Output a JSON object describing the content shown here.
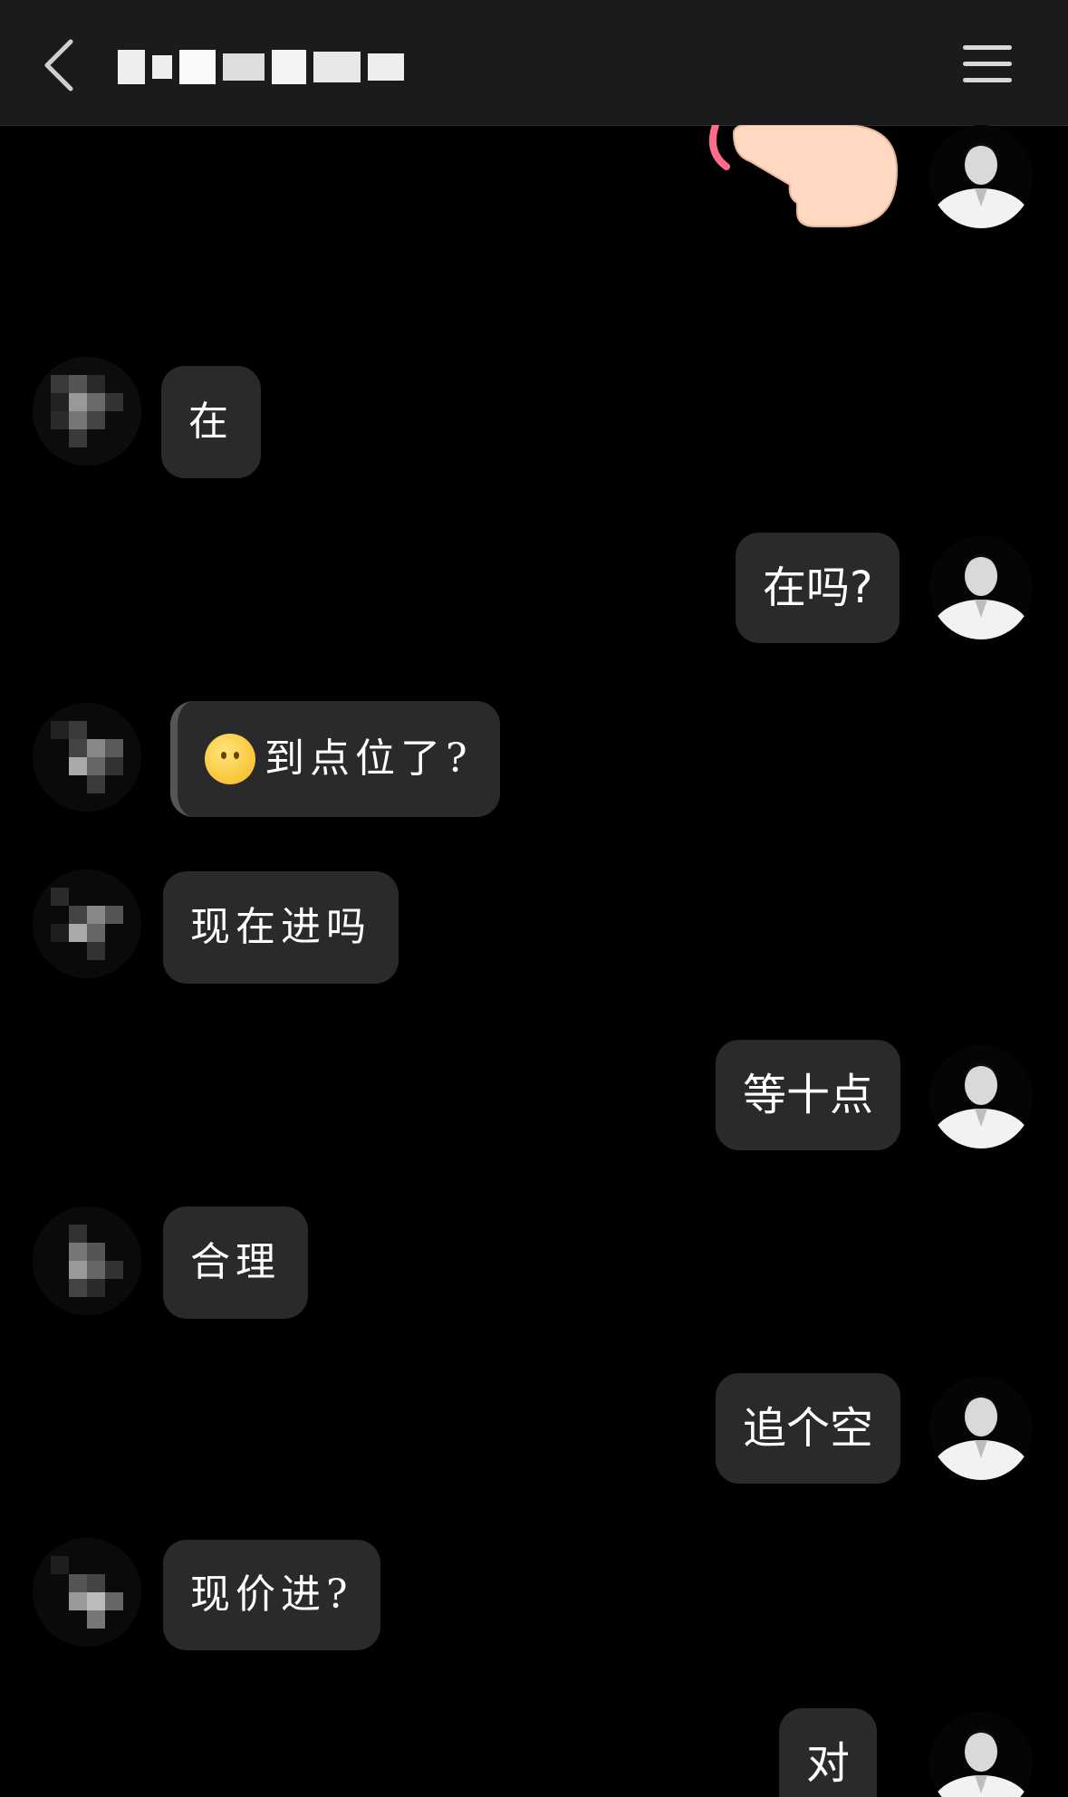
{
  "header": {
    "title": "redacted contact name",
    "back_icon": "chevron-left-icon",
    "menu_icon": "hamburger-menu-icon"
  },
  "messages": [
    {
      "from": "me",
      "type": "sticker",
      "sticker": "pointing-hand-sticker"
    },
    {
      "from": "other",
      "text": "在"
    },
    {
      "from": "me",
      "text": "在吗?"
    },
    {
      "from": "other",
      "emoji": "thinking-face-emoji",
      "text": "到点位了?"
    },
    {
      "from": "other",
      "text": "现在进吗"
    },
    {
      "from": "me",
      "text": "等十点"
    },
    {
      "from": "other",
      "text": "合理"
    },
    {
      "from": "me",
      "text": "追个空"
    },
    {
      "from": "other",
      "text": "现价进?"
    },
    {
      "from": "me",
      "text": "对"
    }
  ],
  "colors": {
    "background": "#000000",
    "header": "#1b1b1d",
    "bubble": "#2a2a2d",
    "text": "#ffffff"
  }
}
